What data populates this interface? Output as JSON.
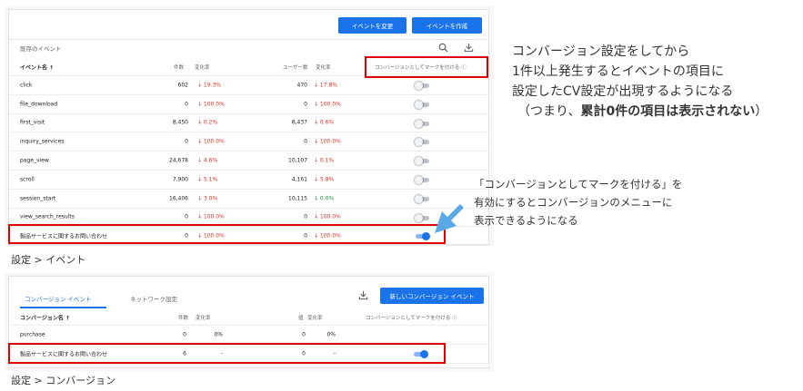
{
  "events_panel": {
    "buttons": {
      "modify": "イベントを変更",
      "create": "イベントを作成"
    },
    "table_title": "既存のイベント",
    "columns": {
      "name": "イベント名 ↑",
      "count": "件数",
      "change1": "変化率",
      "users": "ユーザー数",
      "change2": "変化率",
      "mark": "コンバージョンとしてマークを付ける ⓘ"
    },
    "rows": [
      {
        "name": "click",
        "count": "602",
        "c1": "↓ 19.3%",
        "c1_dir": "down",
        "users": "470",
        "c2": "↓ 17.8%",
        "c2_dir": "down",
        "toggle": false
      },
      {
        "name": "file_download",
        "count": "0",
        "c1": "↓ 100.0%",
        "c1_dir": "down",
        "users": "0",
        "c2": "↓ 100.0%",
        "c2_dir": "down",
        "toggle": false
      },
      {
        "name": "first_visit",
        "count": "8,450",
        "c1": "↓ 0.2%",
        "c1_dir": "down",
        "users": "8,437",
        "c2": "↓ 0.6%",
        "c2_dir": "down",
        "toggle": false
      },
      {
        "name": "inquiry_services",
        "count": "0",
        "c1": "↓ 100.0%",
        "c1_dir": "down",
        "users": "0",
        "c2": "↓ 100.0%",
        "c2_dir": "down",
        "toggle": false
      },
      {
        "name": "page_view",
        "count": "24,678",
        "c1": "↓ 4.6%",
        "c1_dir": "down",
        "users": "10,107",
        "c2": "↓ 0.1%",
        "c2_dir": "down",
        "toggle": false
      },
      {
        "name": "scroll",
        "count": "7,900",
        "c1": "↓ 5.1%",
        "c1_dir": "down",
        "users": "4,161",
        "c2": "↓ 5.8%",
        "c2_dir": "down",
        "toggle": false
      },
      {
        "name": "session_start",
        "count": "16,406",
        "c1": "↓ 3.0%",
        "c1_dir": "down",
        "users": "10,115",
        "c2": "↓ 0.0%",
        "c2_dir": "up",
        "toggle": false
      },
      {
        "name": "view_search_results",
        "count": "0",
        "c1": "↓ 100.0%",
        "c1_dir": "down",
        "users": "0",
        "c2": "↓ 100.0%",
        "c2_dir": "down",
        "toggle": false
      },
      {
        "name": "製品サービスに関するお問い合わせ",
        "count": "0",
        "c1": "↓ 100.0%",
        "c1_dir": "down",
        "users": "0",
        "c2": "↓ 100.0%",
        "c2_dir": "down",
        "toggle": true
      }
    ],
    "caption": "設定 > イベント"
  },
  "conversions_panel": {
    "tabs": {
      "conversion_events": "コンバージョン イベント",
      "network": "ネットワーク設定"
    },
    "new_button": "新しいコンバージョン イベント",
    "columns": {
      "name": "コンバージョン名 ↑",
      "count": "件数",
      "change1": "変化率",
      "value": "値",
      "change2": "変化率",
      "mark": "コンバージョンとしてマークを付ける ⓘ"
    },
    "rows": [
      {
        "name": "purchase",
        "count": "0",
        "c1": "0%",
        "value": "0",
        "c2": "0%",
        "toggle": false,
        "toggle_visible": false
      },
      {
        "name": "製品サービスに関するお問い合わせ",
        "count": "6",
        "c1": "-",
        "value": "0",
        "c2": "-",
        "toggle": true,
        "toggle_visible": true
      }
    ],
    "caption": "設定 > コンバージョン"
  },
  "notes": {
    "main": [
      "コンバージョン設定をしてから",
      "1件以上発生するとイベントの項目に",
      "設定したCV設定が出現するようになる"
    ],
    "paren_open": "（つまり、",
    "paren_bold": "累計0件の項目は表示されない",
    "paren_close": "）",
    "callout": [
      "「コンバージョンとしてマークを付ける」を",
      "有効にするとコンバージョンのメニューに",
      "表示できるようになる"
    ]
  },
  "colors": {
    "accent": "#1a73e8",
    "highlight": "#e00000",
    "arrow": "#5aa9e6",
    "down": "#d93025",
    "up": "#1e8e3e"
  }
}
